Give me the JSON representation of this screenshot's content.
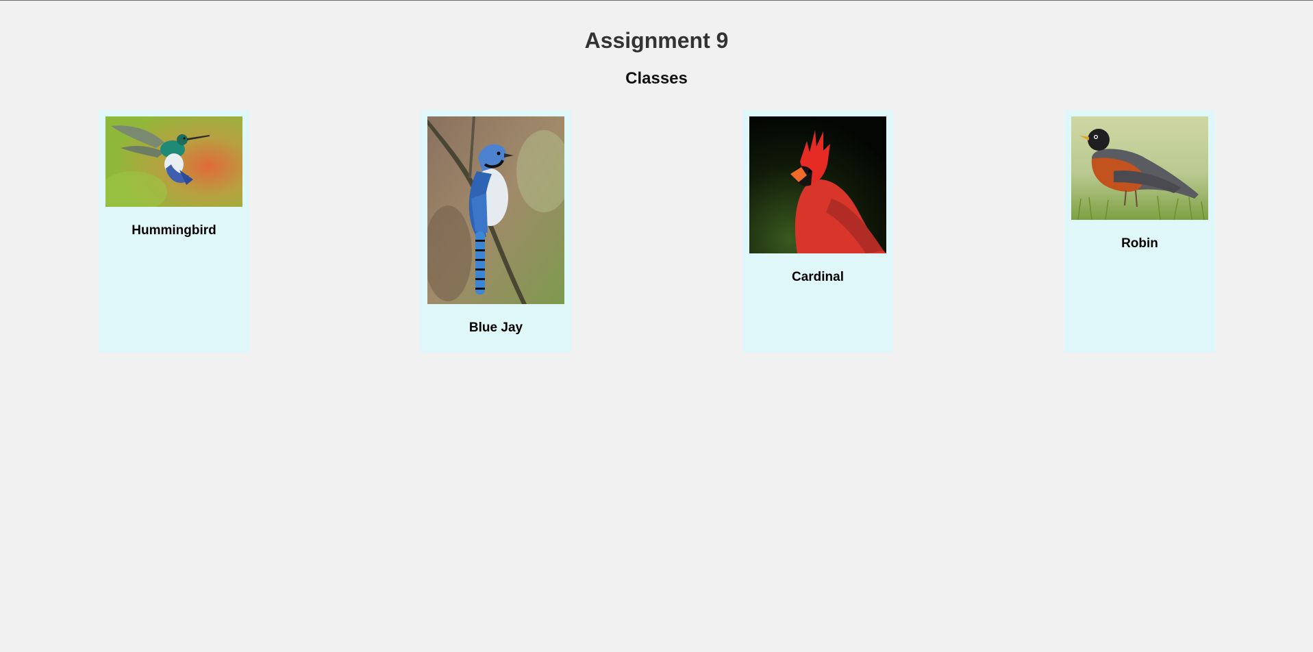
{
  "page": {
    "title": "Assignment 9",
    "subtitle": "Classes"
  },
  "cards": [
    {
      "label": "Hummingbird",
      "image": "hummingbird-photo"
    },
    {
      "label": "Blue Jay",
      "image": "blue-jay-photo"
    },
    {
      "label": "Cardinal",
      "image": "cardinal-photo"
    },
    {
      "label": "Robin",
      "image": "robin-photo"
    }
  ],
  "colors": {
    "background": "#f1f1f1",
    "card_background": "#e0f7fa",
    "title_text": "#333333"
  }
}
